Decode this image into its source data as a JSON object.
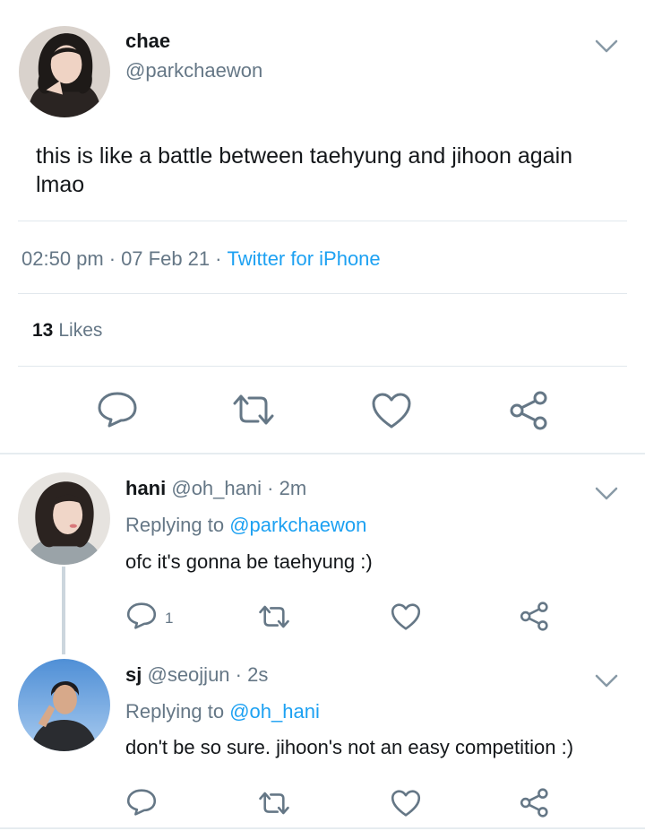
{
  "main_tweet": {
    "display_name": "chae",
    "handle": "@parkchaewon",
    "text": "this is like a battle between taehyung and jihoon again lmao",
    "time": "02:50 pm",
    "date": "07 Feb 21",
    "separator": "·",
    "source": "Twitter for iPhone",
    "likes_count": "13",
    "likes_label": "Likes"
  },
  "replies": [
    {
      "display_name": "hani",
      "handle": "@oh_hani",
      "separator": "·",
      "time": "2m",
      "replying_label": "Replying to",
      "replying_to": "@parkchaewon",
      "text": "ofc it's gonna be taehyung :)",
      "reply_count": "1"
    },
    {
      "display_name": "sj",
      "handle": "@seojjun",
      "separator": "·",
      "time": "2s",
      "replying_label": "Replying to",
      "replying_to": "@oh_hani",
      "text": "don't be so sure. jihoon's not an easy competition :)",
      "reply_count": ""
    }
  ],
  "colors": {
    "accent": "#1da1f2",
    "secondary_text": "#657786",
    "icon": "#657786"
  }
}
